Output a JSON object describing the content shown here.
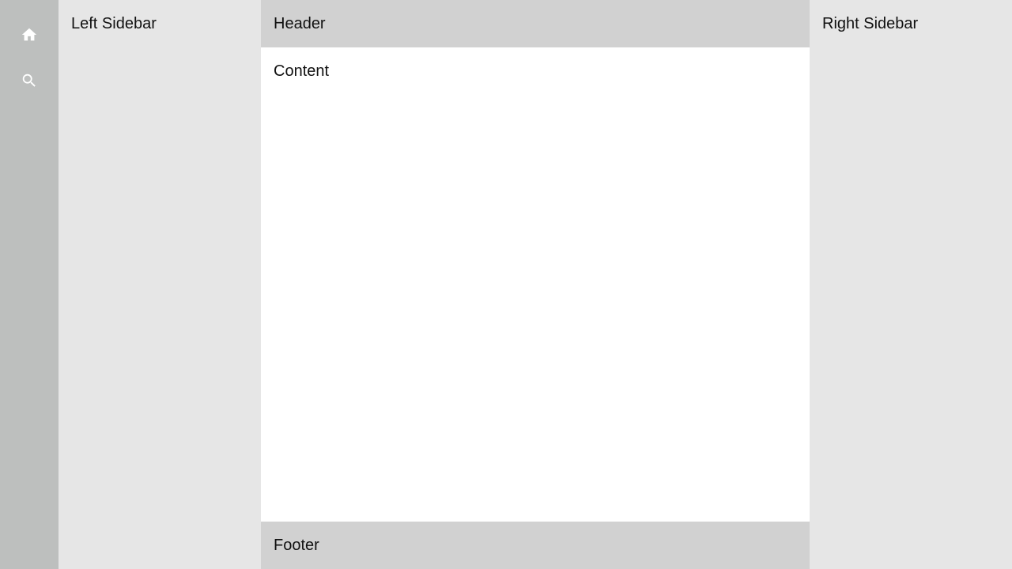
{
  "icon_rail": {
    "items": [
      {
        "icon": "home-icon"
      },
      {
        "icon": "search-icon"
      }
    ]
  },
  "left_sidebar": {
    "title": "Left Sidebar"
  },
  "header": {
    "title": "Header"
  },
  "content": {
    "title": "Content"
  },
  "footer": {
    "title": "Footer"
  },
  "right_sidebar": {
    "title": "Right Sidebar"
  },
  "colors": {
    "rail_bg": "#bdbfbe",
    "sidebar_bg": "#e6e6e6",
    "header_footer_bg": "#d1d1d1",
    "content_bg": "#ffffff",
    "icon": "#ffffff"
  }
}
